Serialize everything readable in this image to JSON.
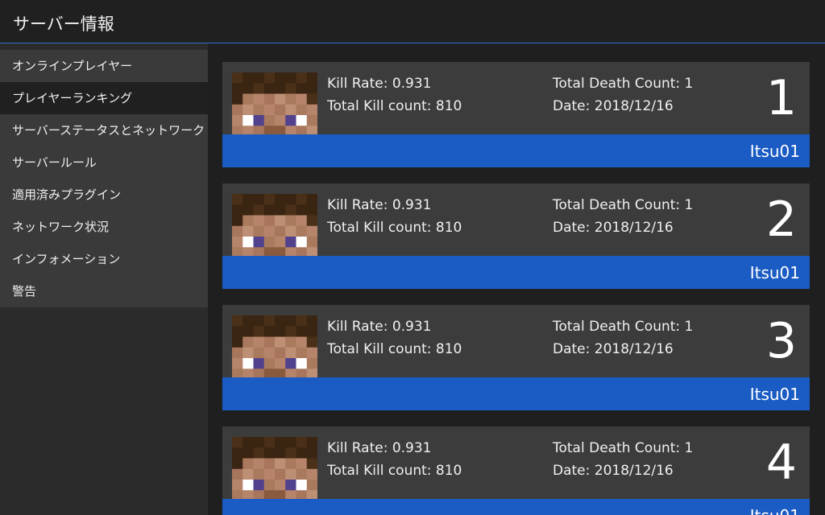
{
  "window": {
    "title": "サーバー情報"
  },
  "sidebar": {
    "items": [
      {
        "label": "オンラインプレイヤー",
        "active": false
      },
      {
        "label": "プレイヤーランキング",
        "active": true
      },
      {
        "label": "サーバーステータスとネットワーク",
        "active": false
      },
      {
        "label": "サーバールール",
        "active": false
      },
      {
        "label": "適用済みプラグイン",
        "active": false
      },
      {
        "label": "ネットワーク状況",
        "active": false
      },
      {
        "label": "インフォメーション",
        "active": false
      },
      {
        "label": "警告",
        "active": false
      }
    ]
  },
  "ranking": [
    {
      "rank": "1",
      "kill_rate": "Kill Rate: 0.931",
      "kill_count": "Total Kill count: 810",
      "death_count": "Total Death Count: 1",
      "date": "Date: 2018/12/16",
      "player": "Itsu01",
      "avatar_icon": "player-head-icon"
    },
    {
      "rank": "2",
      "kill_rate": "Kill Rate: 0.931",
      "kill_count": "Total Kill count: 810",
      "death_count": "Total Death Count: 1",
      "date": "Date: 2018/12/16",
      "player": "Itsu01",
      "avatar_icon": "player-head-icon"
    },
    {
      "rank": "3",
      "kill_rate": "Kill Rate: 0.931",
      "kill_count": "Total Kill count: 810",
      "death_count": "Total Death Count: 1",
      "date": "Date: 2018/12/16",
      "player": "Itsu01",
      "avatar_icon": "player-head-icon"
    },
    {
      "rank": "4",
      "kill_rate": "Kill Rate: 0.931",
      "kill_count": "Total Kill count: 810",
      "death_count": "Total Death Count: 1",
      "date": "Date: 2018/12/16",
      "player": "Itsu01",
      "avatar_icon": "player-head-icon"
    }
  ],
  "colors": {
    "accent": "#1a5bc4",
    "card": "#3c3c3c",
    "sidebar": "#3a3a3a",
    "sidebar_active": "#202020"
  }
}
